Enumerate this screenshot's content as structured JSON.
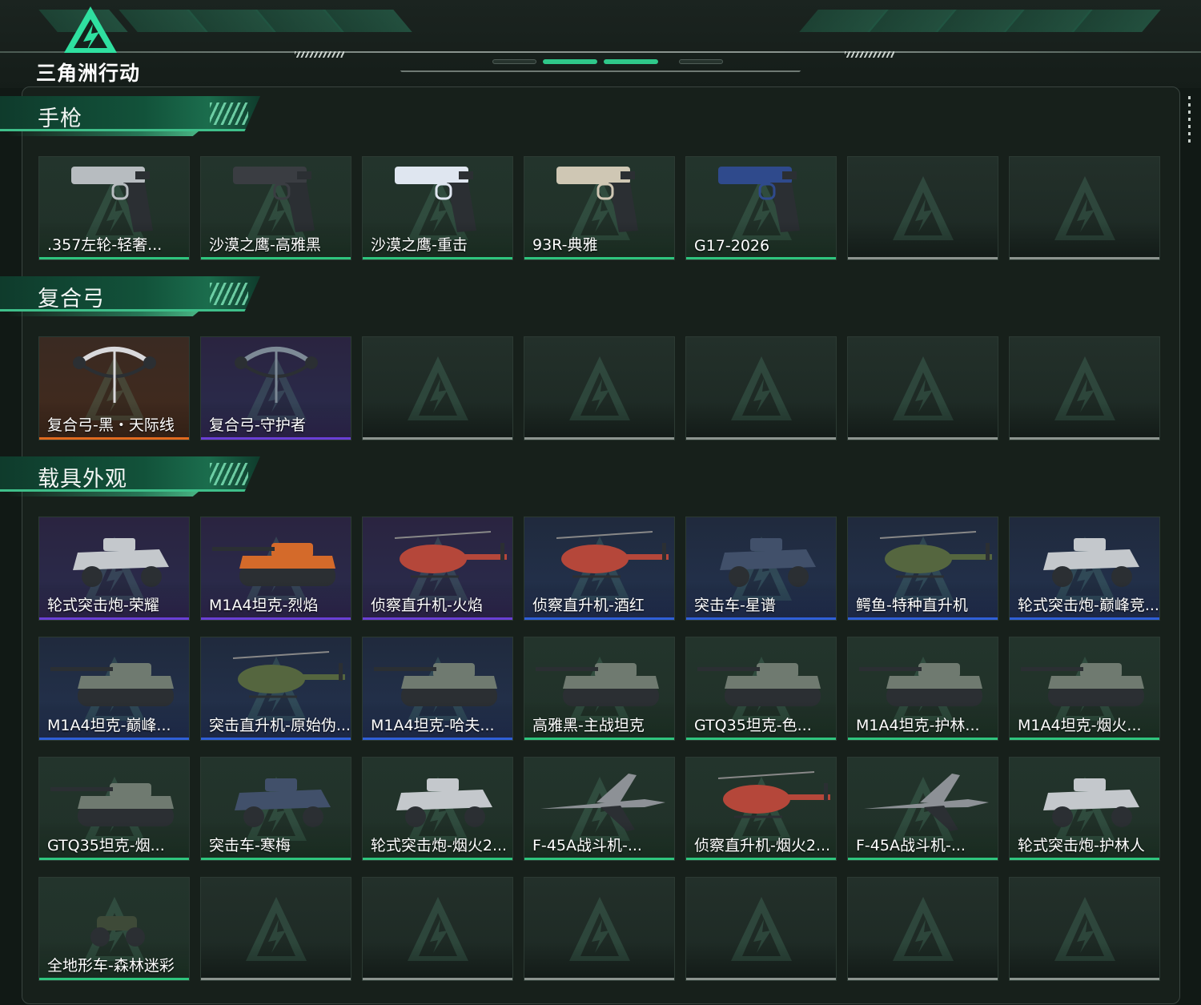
{
  "brand": {
    "logo_text": "三角洲行动",
    "logo_icon": "delta-triangle-icon"
  },
  "colors": {
    "accent": "#2fbf7f",
    "rarity": {
      "green": "#2fc57e",
      "blue": "#2f5fd8",
      "purple": "#6a3fd6",
      "orange": "#e06a1f",
      "gray": "#8c948f"
    }
  },
  "sections": [
    {
      "title": "手枪",
      "items": [
        {
          "label": ".357左轮-轻奢...",
          "rarity": "green",
          "icon": "revolver-icon"
        },
        {
          "label": "沙漠之鹰-高雅黑",
          "rarity": "green",
          "icon": "pistol-black-icon"
        },
        {
          "label": "沙漠之鹰-重击",
          "rarity": "green",
          "icon": "pistol-white-blue-icon"
        },
        {
          "label": "93R-典雅",
          "rarity": "green",
          "icon": "pistol-beige-icon"
        },
        {
          "label": "G17-2026",
          "rarity": "green",
          "icon": "pistol-navy-icon"
        },
        {
          "label": "",
          "rarity": "gray",
          "icon": ""
        },
        {
          "label": "",
          "rarity": "gray",
          "icon": ""
        }
      ]
    },
    {
      "title": "复合弓",
      "items": [
        {
          "label": "复合弓-黑・天际线",
          "rarity": "orange",
          "icon": "compound-bow-icon"
        },
        {
          "label": "复合弓-守护者",
          "rarity": "purple",
          "icon": "compound-bow-folded-icon"
        },
        {
          "label": "",
          "rarity": "gray",
          "icon": ""
        },
        {
          "label": "",
          "rarity": "gray",
          "icon": ""
        },
        {
          "label": "",
          "rarity": "gray",
          "icon": ""
        },
        {
          "label": "",
          "rarity": "gray",
          "icon": ""
        },
        {
          "label": "",
          "rarity": "gray",
          "icon": ""
        }
      ]
    },
    {
      "title": "载具外观",
      "items": [
        {
          "label": "轮式突击炮-荣耀",
          "rarity": "purple",
          "icon": "armored-car-icon"
        },
        {
          "label": "M1A4坦克-烈焰",
          "rarity": "purple",
          "icon": "tank-flame-icon"
        },
        {
          "label": "侦察直升机-火焰",
          "rarity": "purple",
          "icon": "helicopter-icon"
        },
        {
          "label": "侦察直升机-酒红",
          "rarity": "blue",
          "icon": "helicopter-icon"
        },
        {
          "label": "突击车-星谱",
          "rarity": "blue",
          "icon": "assault-vehicle-icon"
        },
        {
          "label": "鳄鱼-特种直升机",
          "rarity": "blue",
          "icon": "attack-helicopter-icon"
        },
        {
          "label": "轮式突击炮-巅峰竞...",
          "rarity": "blue",
          "icon": "armored-car-icon"
        },
        {
          "label": "M1A4坦克-巅峰...",
          "rarity": "blue",
          "icon": "tank-icon"
        },
        {
          "label": "突击直升机-原始伪...",
          "rarity": "blue",
          "icon": "attack-helicopter-icon"
        },
        {
          "label": "M1A4坦克-哈夫...",
          "rarity": "blue",
          "icon": "tank-icon"
        },
        {
          "label": "高雅黑-主战坦克",
          "rarity": "green",
          "icon": "tank-icon"
        },
        {
          "label": "GTQ35坦克-色...",
          "rarity": "green",
          "icon": "tank-icon"
        },
        {
          "label": "M1A4坦克-护林...",
          "rarity": "green",
          "icon": "tank-icon"
        },
        {
          "label": "M1A4坦克-烟火...",
          "rarity": "green",
          "icon": "tank-icon"
        },
        {
          "label": "GTQ35坦克-烟...",
          "rarity": "green",
          "icon": "tank-icon"
        },
        {
          "label": "突击车-寒梅",
          "rarity": "green",
          "icon": "assault-vehicle-icon"
        },
        {
          "label": "轮式突击炮-烟火2...",
          "rarity": "green",
          "icon": "armored-car-icon"
        },
        {
          "label": "F-45A战斗机-...",
          "rarity": "green",
          "icon": "fighter-jet-icon"
        },
        {
          "label": "侦察直升机-烟火2...",
          "rarity": "green",
          "icon": "helicopter-icon"
        },
        {
          "label": "F-45A战斗机-...",
          "rarity": "green",
          "icon": "fighter-jet-icon"
        },
        {
          "label": "轮式突击炮-护林人",
          "rarity": "green",
          "icon": "armored-car-icon"
        },
        {
          "label": "全地形车-森林迷彩",
          "rarity": "green",
          "icon": "atv-icon"
        },
        {
          "label": "",
          "rarity": "gray",
          "icon": ""
        },
        {
          "label": "",
          "rarity": "gray",
          "icon": ""
        },
        {
          "label": "",
          "rarity": "gray",
          "icon": ""
        },
        {
          "label": "",
          "rarity": "gray",
          "icon": ""
        },
        {
          "label": "",
          "rarity": "gray",
          "icon": ""
        },
        {
          "label": "",
          "rarity": "gray",
          "icon": ""
        }
      ]
    }
  ]
}
